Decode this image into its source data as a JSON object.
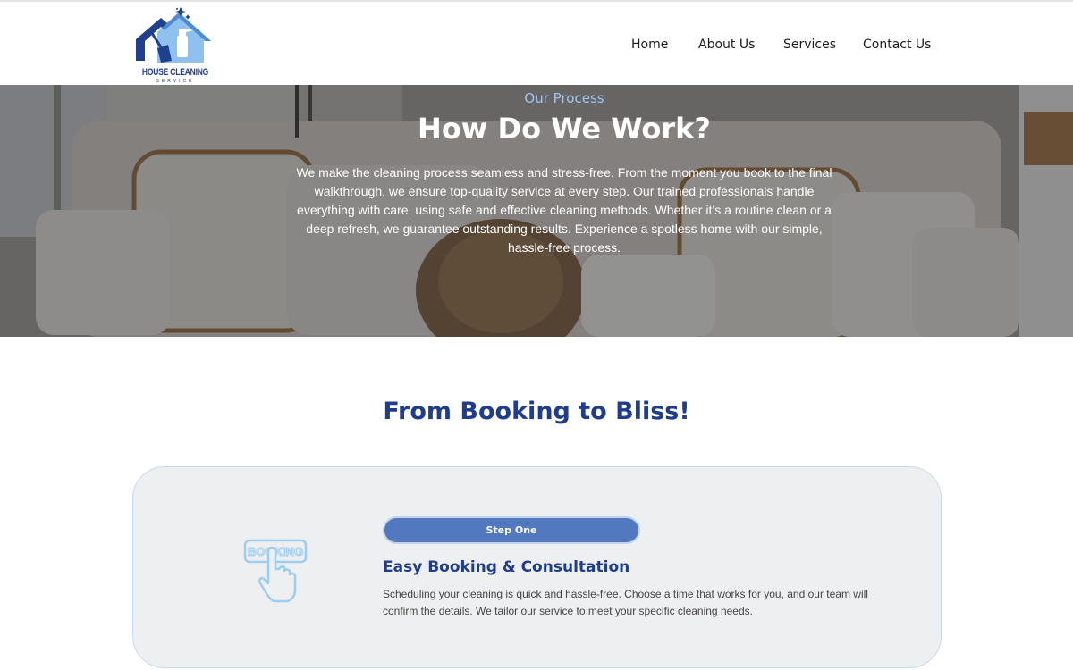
{
  "brand": {
    "logo_text": "HOUSE CLEANING",
    "logo_subtext": "SERVICE"
  },
  "nav": {
    "items": [
      {
        "label": "Home"
      },
      {
        "label": "About Us"
      },
      {
        "label": "Services"
      },
      {
        "label": "Contact Us"
      }
    ]
  },
  "hero": {
    "kicker": "Our Process",
    "title": "How Do We Work?",
    "text": "We make the cleaning process seamless and stress-free. From the moment you book to the final walkthrough, we ensure top-quality service at every step. Our trained professionals handle everything with care, using safe and effective cleaning methods. Whether it’s a routine clean or a deep refresh, we guarantee outstanding results. Experience a spotless home with our simple, hassle-free process."
  },
  "section": {
    "title": "From Booking to Bliss!"
  },
  "steps": [
    {
      "button_label": "Step One",
      "icon": "booking-hand-icon",
      "icon_label": "BOOKING",
      "title": "Easy Booking & Consultation",
      "text": "Scheduling your cleaning is quick and hassle-free. Choose a time that works for you, and our team will confirm the details. We tailor our service to meet your specific cleaning needs."
    }
  ],
  "colors": {
    "accent_blue": "#1f3d8c",
    "button_blue": "#5279bf",
    "kicker_blue": "#9fc4f3",
    "icon_light_blue": "#9ccdf3"
  }
}
